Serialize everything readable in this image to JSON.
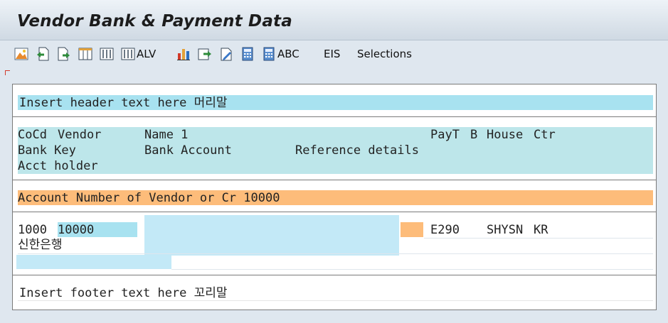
{
  "window": {
    "title": "Vendor Bank & Payment Data"
  },
  "toolbar": {
    "alv_label": "ALV",
    "abc_label": "ABC",
    "eis_label": "EIS",
    "selections_label": "Selections"
  },
  "report": {
    "header_text": "Insert header text here 머리말",
    "column_headers": {
      "row1": [
        "CoCd",
        "Vendor",
        "Name 1",
        "PayT",
        "B",
        "House",
        "Ctr"
      ],
      "row2": [
        "Bank Key",
        "Bank Account",
        "Reference details"
      ],
      "row3": [
        "Acct holder"
      ]
    },
    "group_header": "Account Number of Vendor or Cr 10000",
    "data_row": {
      "cocd": "1000",
      "vendor": "10000",
      "payt": "E290",
      "house_bank": "SHYSN",
      "country": "KR",
      "bank_key": "신한은행"
    },
    "footer_text": "Insert footer text here 꼬리말"
  },
  "colors": {
    "header_bg": "#a8e2f0",
    "column_header_bg": "#bde6ea",
    "group_header_bg": "#fdbc7a",
    "highlight_cell": "#a8e2f0",
    "redacted": "#c3e9f7"
  }
}
